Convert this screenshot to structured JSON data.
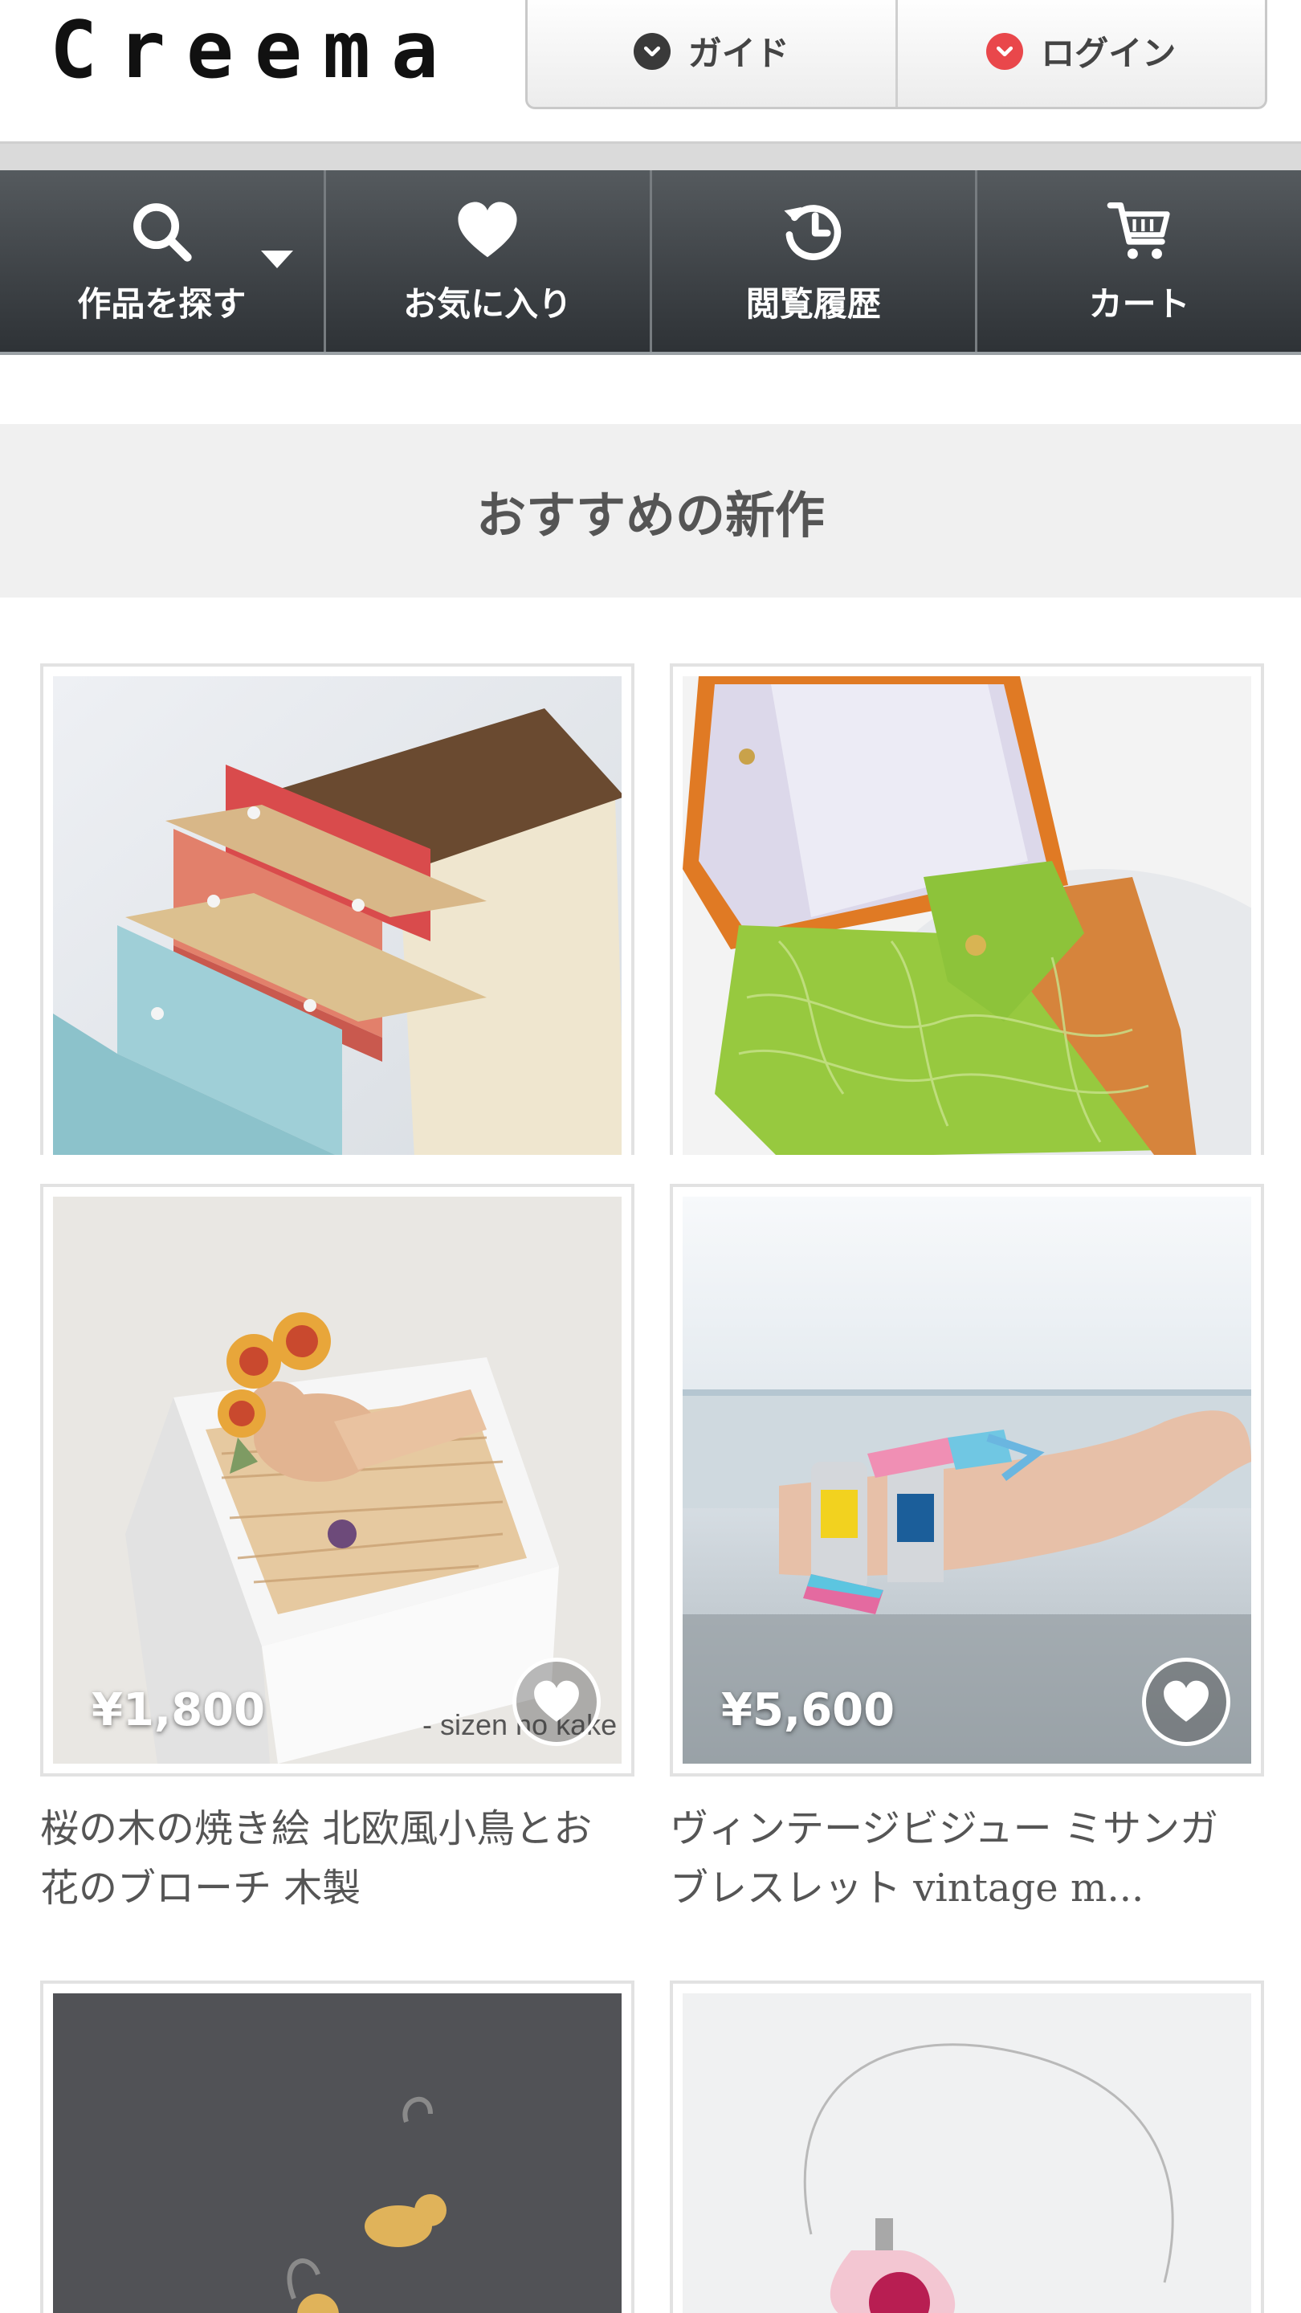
{
  "header": {
    "logo_text": "Creema",
    "guide_label": "ガイド",
    "login_label": "ログイン"
  },
  "nav": {
    "items": [
      {
        "label": "作品を探す",
        "icon": "search-icon"
      },
      {
        "label": "お気に入り",
        "icon": "heart-icon"
      },
      {
        "label": "閲覧履歴",
        "icon": "history-icon"
      },
      {
        "label": "カート",
        "icon": "cart-icon"
      }
    ]
  },
  "section": {
    "title": "おすすめの新作"
  },
  "products": [
    {
      "price": "",
      "title": ""
    },
    {
      "price": "",
      "title": ""
    },
    {
      "price": "¥1,800",
      "title_line1": "桜の木の焼き絵 北欧風小鳥とお",
      "title_line2": "花のブローチ 木製",
      "watermark": "- sizen no kake"
    },
    {
      "price": "¥5,600",
      "title_line1": "ヴィンテージビジュー ミサンガ",
      "title_line2": "ブレスレット vintage m..."
    },
    {
      "price": "",
      "title": ""
    },
    {
      "price": "",
      "title": ""
    }
  ],
  "colors": {
    "navbar_top": "#555a5e",
    "navbar_bottom": "#2e3236",
    "login_accent": "#e9474b",
    "section_bg": "#f0f0f0"
  }
}
